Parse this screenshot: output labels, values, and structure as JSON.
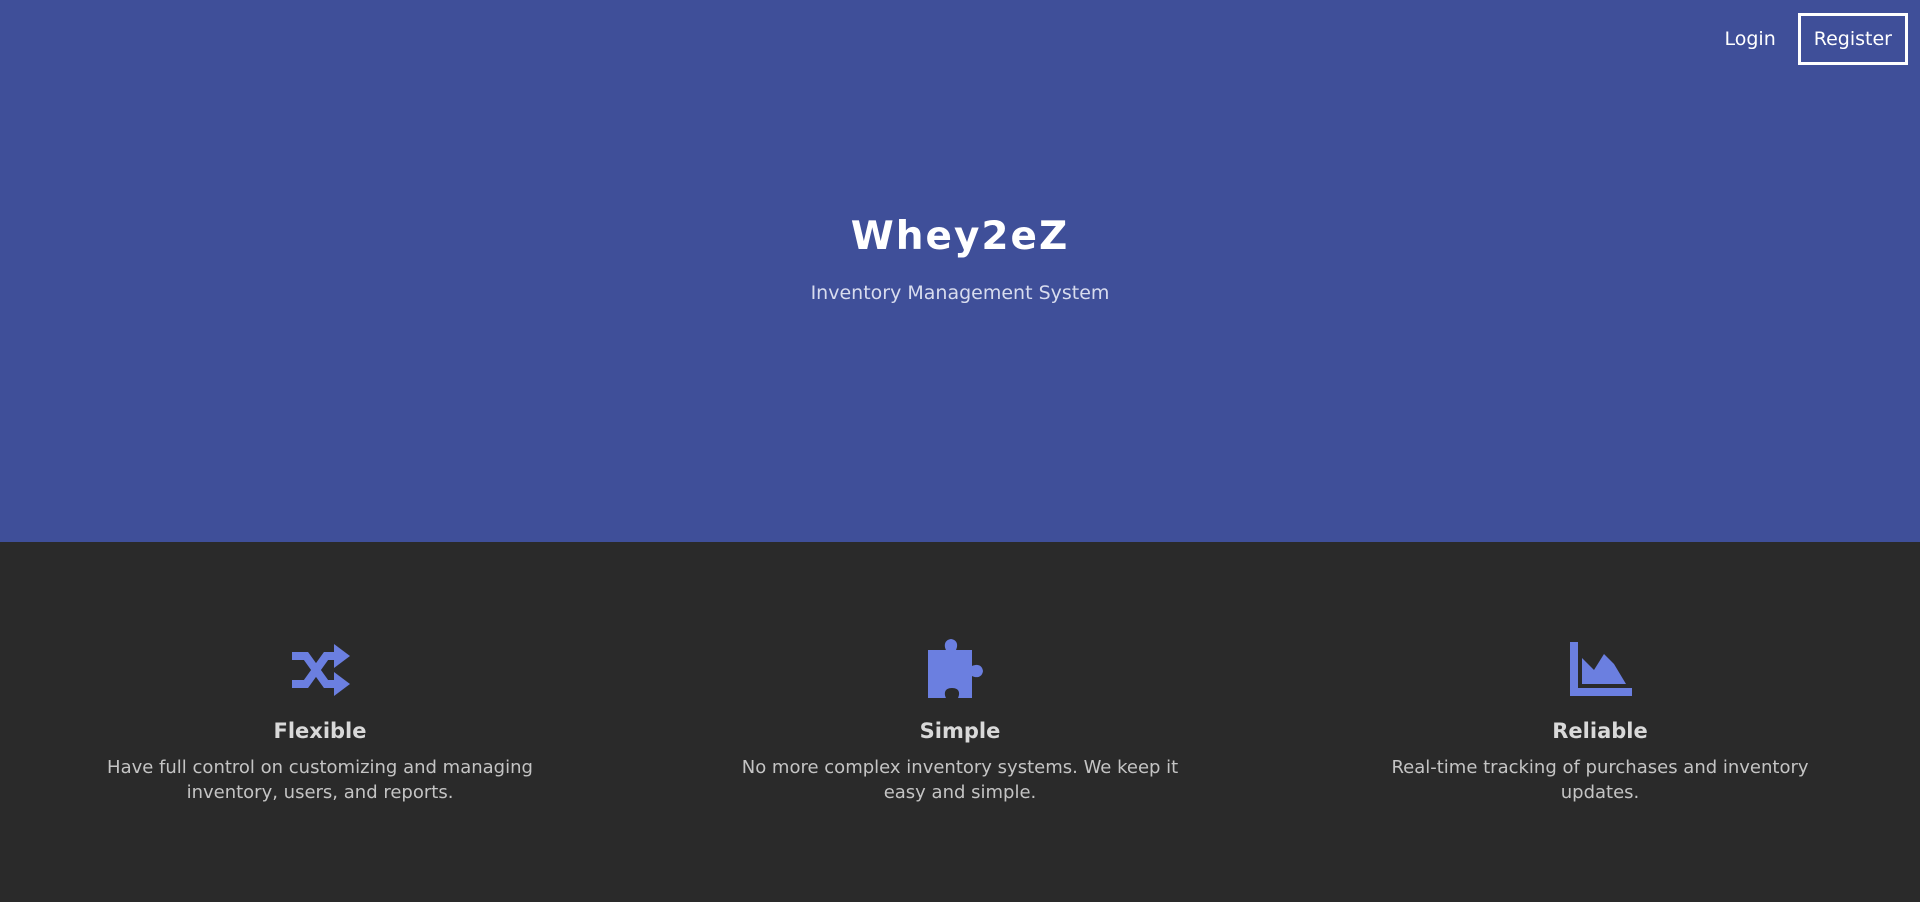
{
  "nav": {
    "login_label": "Login",
    "register_label": "Register"
  },
  "hero": {
    "title": "Whey2eZ",
    "subtitle": "Inventory Management System"
  },
  "features": [
    {
      "icon": "shuffle-icon",
      "title": "Flexible",
      "text": "Have full control on customizing and managing inventory, users, and reports."
    },
    {
      "icon": "puzzle-piece-icon",
      "title": "Simple",
      "text": "No more complex inventory systems. We keep it easy and simple."
    },
    {
      "icon": "area-chart-icon",
      "title": "Reliable",
      "text": "Real-time tracking of purchases and inventory updates."
    }
  ],
  "colors": {
    "hero_background": "#3f4f99",
    "features_background": "#2a2a2a",
    "icon_accent": "#6b7fe0"
  }
}
